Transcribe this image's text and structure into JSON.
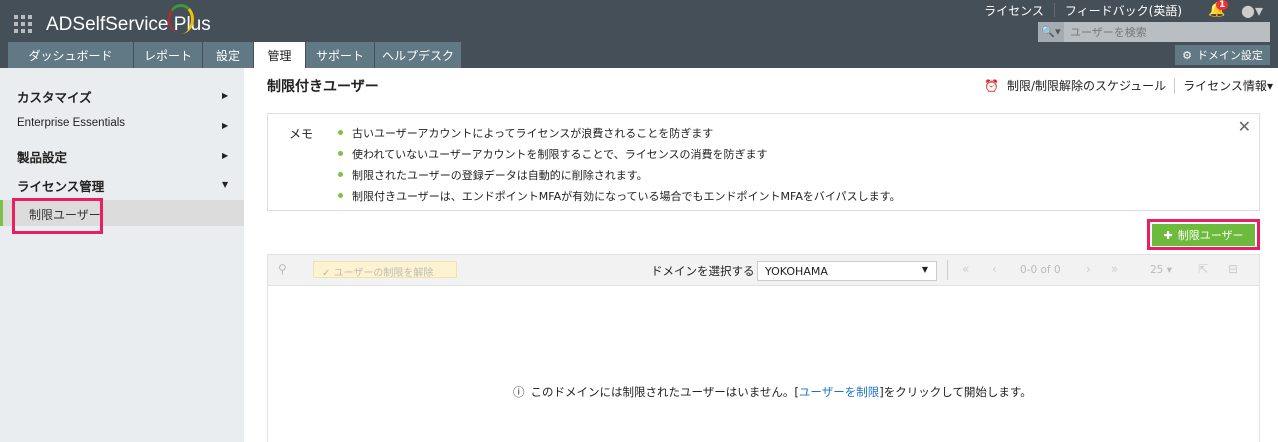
{
  "header": {
    "app_name": "ADSelfService Plus",
    "links": [
      "ライセンス",
      "フィードバック(英語)"
    ],
    "notification_count": "1",
    "search_placeholder": "ユーザーを検索",
    "domain_settings": "ドメイン設定",
    "tabs": [
      "ダッシュボード",
      "レポート",
      "設定",
      "管理",
      "サポート",
      "ヘルプデスク"
    ],
    "active_tab": "管理"
  },
  "sidebar": {
    "items": [
      "カスタマイズ",
      "Enterprise Essentials",
      "製品設定",
      "ライセンス管理"
    ],
    "sub_item": "制限ユーザー"
  },
  "main": {
    "title": "制限付きユーザー",
    "schedule": "制限/制限解除のスケジュール",
    "license_info": "ライセンス情報",
    "memo_label": "メモ",
    "memo": [
      "古いユーザーアカウントによってライセンスが浪費されることを防ぎます",
      "使われていないユーザーアカウントを制限することで、ライセンスの消費を防ぎます",
      "制限されたユーザーの登録データは自動的に削除されます。",
      "制限付きユーザーは、エンドポイントMFAが有効になっている場合でもエンドポイントMFAをバイパスします。"
    ],
    "add_button": "制限ユーザー",
    "toolbar": {
      "unrestrict": "ユーザーの制限を解除",
      "domain_label": "ドメインを選択する",
      "domain_value": "YOKOHAMA",
      "page_info": "0-0 of 0",
      "page_size": "25"
    },
    "empty": {
      "before": "このドメインには制限されたユーザーはいません。[",
      "link": "ユーザーを制限",
      "after": "]をクリックして開始します。"
    }
  },
  "colors": {
    "header": "#444f57",
    "accent": "#6cbb3c",
    "highlight": "#ec1e63"
  }
}
